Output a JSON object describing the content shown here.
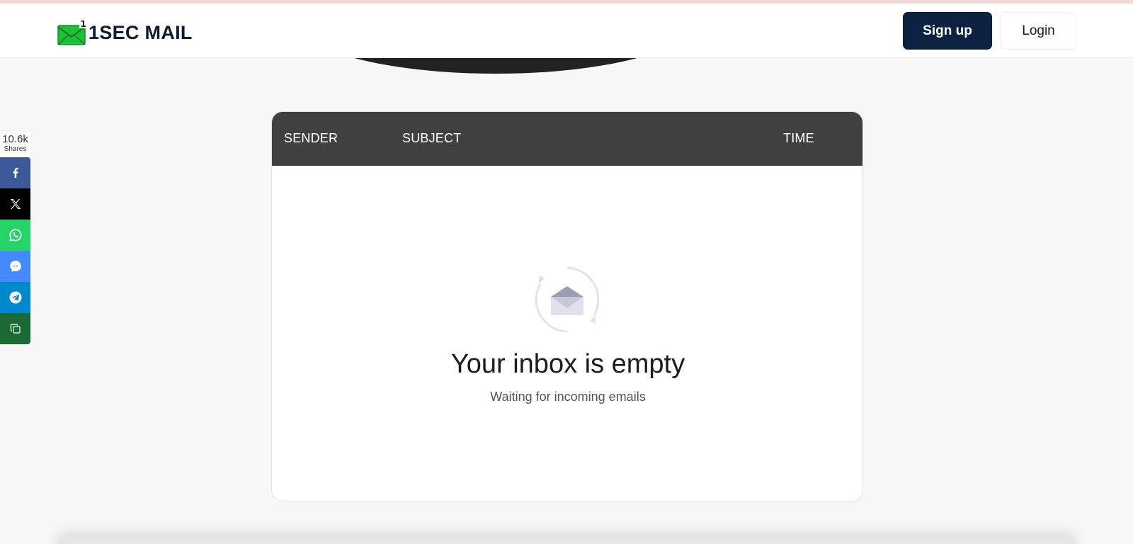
{
  "brand": {
    "name": "1SEC MAIL",
    "logo_icon": "envelope-icon",
    "logo_badge": "1",
    "color_primary": "#0b2240",
    "color_logo": "#1fbf3a"
  },
  "header": {
    "signup_label": "Sign up",
    "login_label": "Login"
  },
  "share": {
    "count": "10.6k",
    "count_label": "Shares",
    "buttons": [
      {
        "name": "facebook",
        "icon": "facebook-icon",
        "color": "#3b5998"
      },
      {
        "name": "x",
        "icon": "x-icon",
        "color": "#000000"
      },
      {
        "name": "whatsapp",
        "icon": "whatsapp-icon",
        "color": "#25d366"
      },
      {
        "name": "messenger",
        "icon": "messenger-icon",
        "color": "#448aff"
      },
      {
        "name": "telegram",
        "icon": "telegram-icon",
        "color": "#0088cc"
      },
      {
        "name": "copy",
        "icon": "copy-icon",
        "color": "#1b6a35"
      }
    ]
  },
  "inbox": {
    "columns": [
      "SENDER",
      "SUBJECT",
      "TIME"
    ],
    "empty_icon": "refresh-envelope-icon",
    "empty_title": "Your inbox is empty",
    "empty_subtitle": "Waiting for incoming emails"
  }
}
